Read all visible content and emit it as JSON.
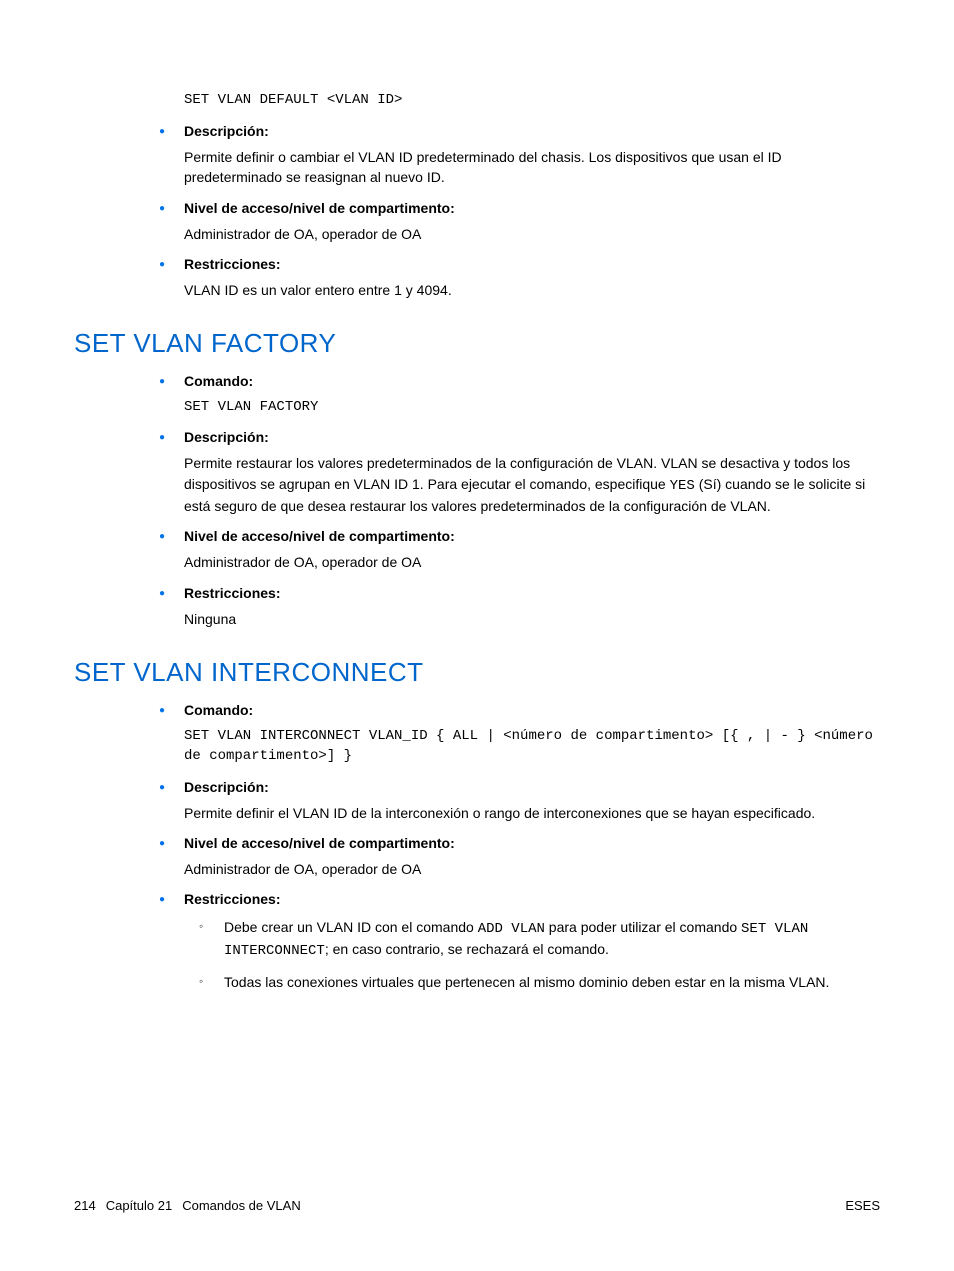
{
  "top_code": "SET VLAN DEFAULT <VLAN ID>",
  "section0": {
    "items": [
      {
        "label": "Descripción:",
        "body": "Permite definir o cambiar el VLAN ID predeterminado del chasis. Los dispositivos que usan el ID predeterminado se reasignan al nuevo ID."
      },
      {
        "label": "Nivel de acceso/nivel de compartimento:",
        "body": "Administrador de OA, operador de OA"
      },
      {
        "label": "Restricciones:",
        "body": "VLAN ID es un valor entero entre 1 y 4094."
      }
    ]
  },
  "section1": {
    "heading": "SET VLAN FACTORY",
    "items": [
      {
        "label": "Comando:",
        "code": "SET VLAN FACTORY"
      },
      {
        "label": "Descripción:",
        "body_pre": "Permite restaurar los valores predeterminados de la configuración de VLAN. VLAN se desactiva y todos los dispositivos se agrupan en VLAN ID 1. Para ejecutar el comando, especifique ",
        "body_code": "YES",
        "body_post": " (Sí) cuando se le solicite si está seguro de que desea restaurar los valores predeterminados de la configuración de VLAN."
      },
      {
        "label": "Nivel de acceso/nivel de compartimento:",
        "body": "Administrador de OA, operador de OA"
      },
      {
        "label": "Restricciones:",
        "body": "Ninguna"
      }
    ]
  },
  "section2": {
    "heading": "SET VLAN INTERCONNECT",
    "items": [
      {
        "label": "Comando:",
        "code": "SET VLAN INTERCONNECT VLAN_ID { ALL | <número de compartimento> [{ , | - } <número de compartimento>] }"
      },
      {
        "label": "Descripción:",
        "body": "Permite definir el VLAN ID de la interconexión o rango de interconexiones que se hayan especificado."
      },
      {
        "label": "Nivel de acceso/nivel de compartimento:",
        "body": "Administrador de OA, operador de OA"
      },
      {
        "label": "Restricciones:",
        "sub": [
          {
            "pre": "Debe crear un VLAN ID con el comando ",
            "code1": "ADD VLAN",
            "mid": " para poder utilizar el comando ",
            "code2": "SET VLAN INTERCONNECT",
            "post": "; en caso contrario, se rechazará el comando."
          },
          {
            "text": "Todas las conexiones virtuales que pertenecen al mismo dominio deben estar en la misma VLAN."
          }
        ]
      }
    ]
  },
  "footer": {
    "page": "214",
    "chapter": "Capítulo 21",
    "title": "Comandos de VLAN",
    "right": "ESES"
  }
}
